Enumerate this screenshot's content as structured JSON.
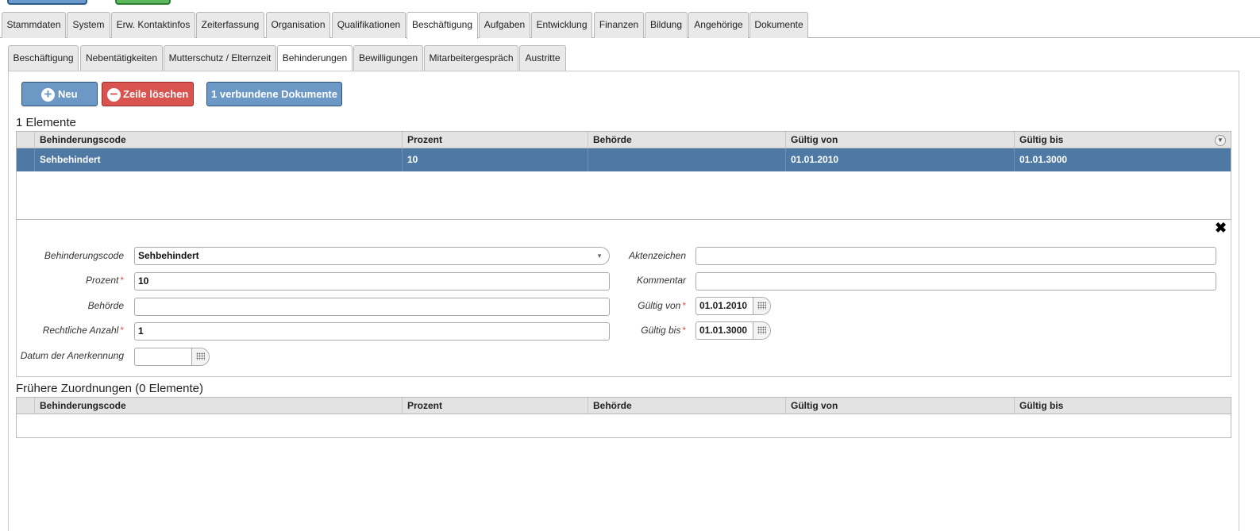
{
  "tabs_main": [
    {
      "label": "Stammdaten"
    },
    {
      "label": "System"
    },
    {
      "label": "Erw. Kontaktinfos"
    },
    {
      "label": "Zeiterfassung"
    },
    {
      "label": "Organisation"
    },
    {
      "label": "Qualifikationen"
    },
    {
      "label": "Beschäftigung"
    },
    {
      "label": "Aufgaben"
    },
    {
      "label": "Entwicklung"
    },
    {
      "label": "Finanzen"
    },
    {
      "label": "Bildung"
    },
    {
      "label": "Angehörige"
    },
    {
      "label": "Dokumente"
    }
  ],
  "tabs_sub": [
    {
      "label": "Beschäftigung"
    },
    {
      "label": "Nebentätigkeiten"
    },
    {
      "label": "Mutterschutz / Elternzeit"
    },
    {
      "label": "Behinderungen"
    },
    {
      "label": "Bewilligungen"
    },
    {
      "label": "Mitarbeitergespräch"
    },
    {
      "label": "Austritte"
    }
  ],
  "toolbar": {
    "new_label": "Neu",
    "delete_label": "Zeile löschen",
    "docs_label": "1 verbundene Dokumente"
  },
  "grid1": {
    "title": "1 Elemente",
    "columns": [
      "Behinderungscode",
      "Prozent",
      "Behörde",
      "Gültig von",
      "Gültig bis"
    ],
    "rows": [
      {
        "code": "Sehbehindert",
        "prozent": "10",
        "behoerde": "",
        "von": "01.01.2010",
        "bis": "01.01.3000"
      }
    ]
  },
  "form": {
    "code_label": "Behinderungscode",
    "code_value": "Sehbehindert",
    "prozent_label": "Prozent",
    "prozent_value": "10",
    "behoerde_label": "Behörde",
    "behoerde_value": "",
    "anzahl_label": "Rechtliche Anzahl",
    "anzahl_value": "1",
    "datum_label": "Datum der Anerkennung",
    "datum_value": "",
    "akten_label": "Aktenzeichen",
    "akten_value": "",
    "kommentar_label": "Kommentar",
    "kommentar_value": "",
    "von_label": "Gültig von",
    "von_value": "01.01.2010",
    "bis_label": "Gültig bis",
    "bis_value": "01.01.3000",
    "required_mark": "*"
  },
  "grid2": {
    "title": "Frühere Zuordnungen (0 Elemente)",
    "columns": [
      "Behinderungscode",
      "Prozent",
      "Behörde",
      "Gültig von",
      "Gültig bis"
    ]
  },
  "icons": {
    "close": "close-icon",
    "add": "plus-circle-icon",
    "remove": "minus-circle-icon",
    "calendar": "calendar-icon",
    "dropdown": "chevron-down-icon"
  },
  "colors": {
    "primary": "#6c98c6",
    "danger": "#d9534f",
    "selected_row": "#4f79a5",
    "success": "#5cb85c"
  }
}
